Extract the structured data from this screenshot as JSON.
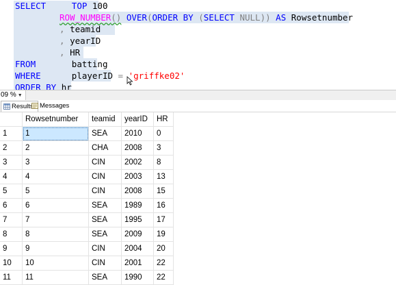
{
  "editor": {
    "line1": {
      "kw1": "SELECT",
      "kw2": "TOP",
      "num": "100"
    },
    "line2": {
      "fn": "ROW_NUMBER",
      "p1": "()",
      "kw_over": "OVER",
      "p2": "(",
      "kw_order": "ORDER BY",
      "p3": "(",
      "kw_select": "SELECT",
      "kw_null": "NULL",
      "p4": "))",
      "kw_as": "AS",
      "alias": "Rowsetnumber"
    },
    "line3": {
      "comma": ",",
      "col": "teamid"
    },
    "line4": {
      "comma": ",",
      "col": "yearID"
    },
    "line5": {
      "comma": ",",
      "col": "HR"
    },
    "line6": {
      "kw": "FROM",
      "table": "batting"
    },
    "line7": {
      "kw": "WHERE",
      "col": "playerID",
      "op": "=",
      "str": "'griffke02'"
    },
    "line8": {
      "kw": "ORDER BY",
      "col": "hr"
    }
  },
  "statusbar": {
    "zoom": "09 %"
  },
  "tabs": {
    "results": "Results",
    "messages": "Messages"
  },
  "grid": {
    "headers": [
      "",
      "Rowsetnumber",
      "teamid",
      "yearID",
      "HR"
    ],
    "rows": [
      [
        "1",
        "1",
        "SEA",
        "2010",
        "0"
      ],
      [
        "2",
        "2",
        "CHA",
        "2008",
        "3"
      ],
      [
        "3",
        "3",
        "CIN",
        "2002",
        "8"
      ],
      [
        "4",
        "4",
        "CIN",
        "2003",
        "13"
      ],
      [
        "5",
        "5",
        "CIN",
        "2008",
        "15"
      ],
      [
        "6",
        "6",
        "SEA",
        "1989",
        "16"
      ],
      [
        "7",
        "7",
        "SEA",
        "1995",
        "17"
      ],
      [
        "8",
        "8",
        "SEA",
        "2009",
        "19"
      ],
      [
        "9",
        "9",
        "CIN",
        "2004",
        "20"
      ],
      [
        "10",
        "10",
        "CIN",
        "2001",
        "22"
      ],
      [
        "11",
        "11",
        "SEA",
        "1990",
        "22"
      ]
    ]
  }
}
